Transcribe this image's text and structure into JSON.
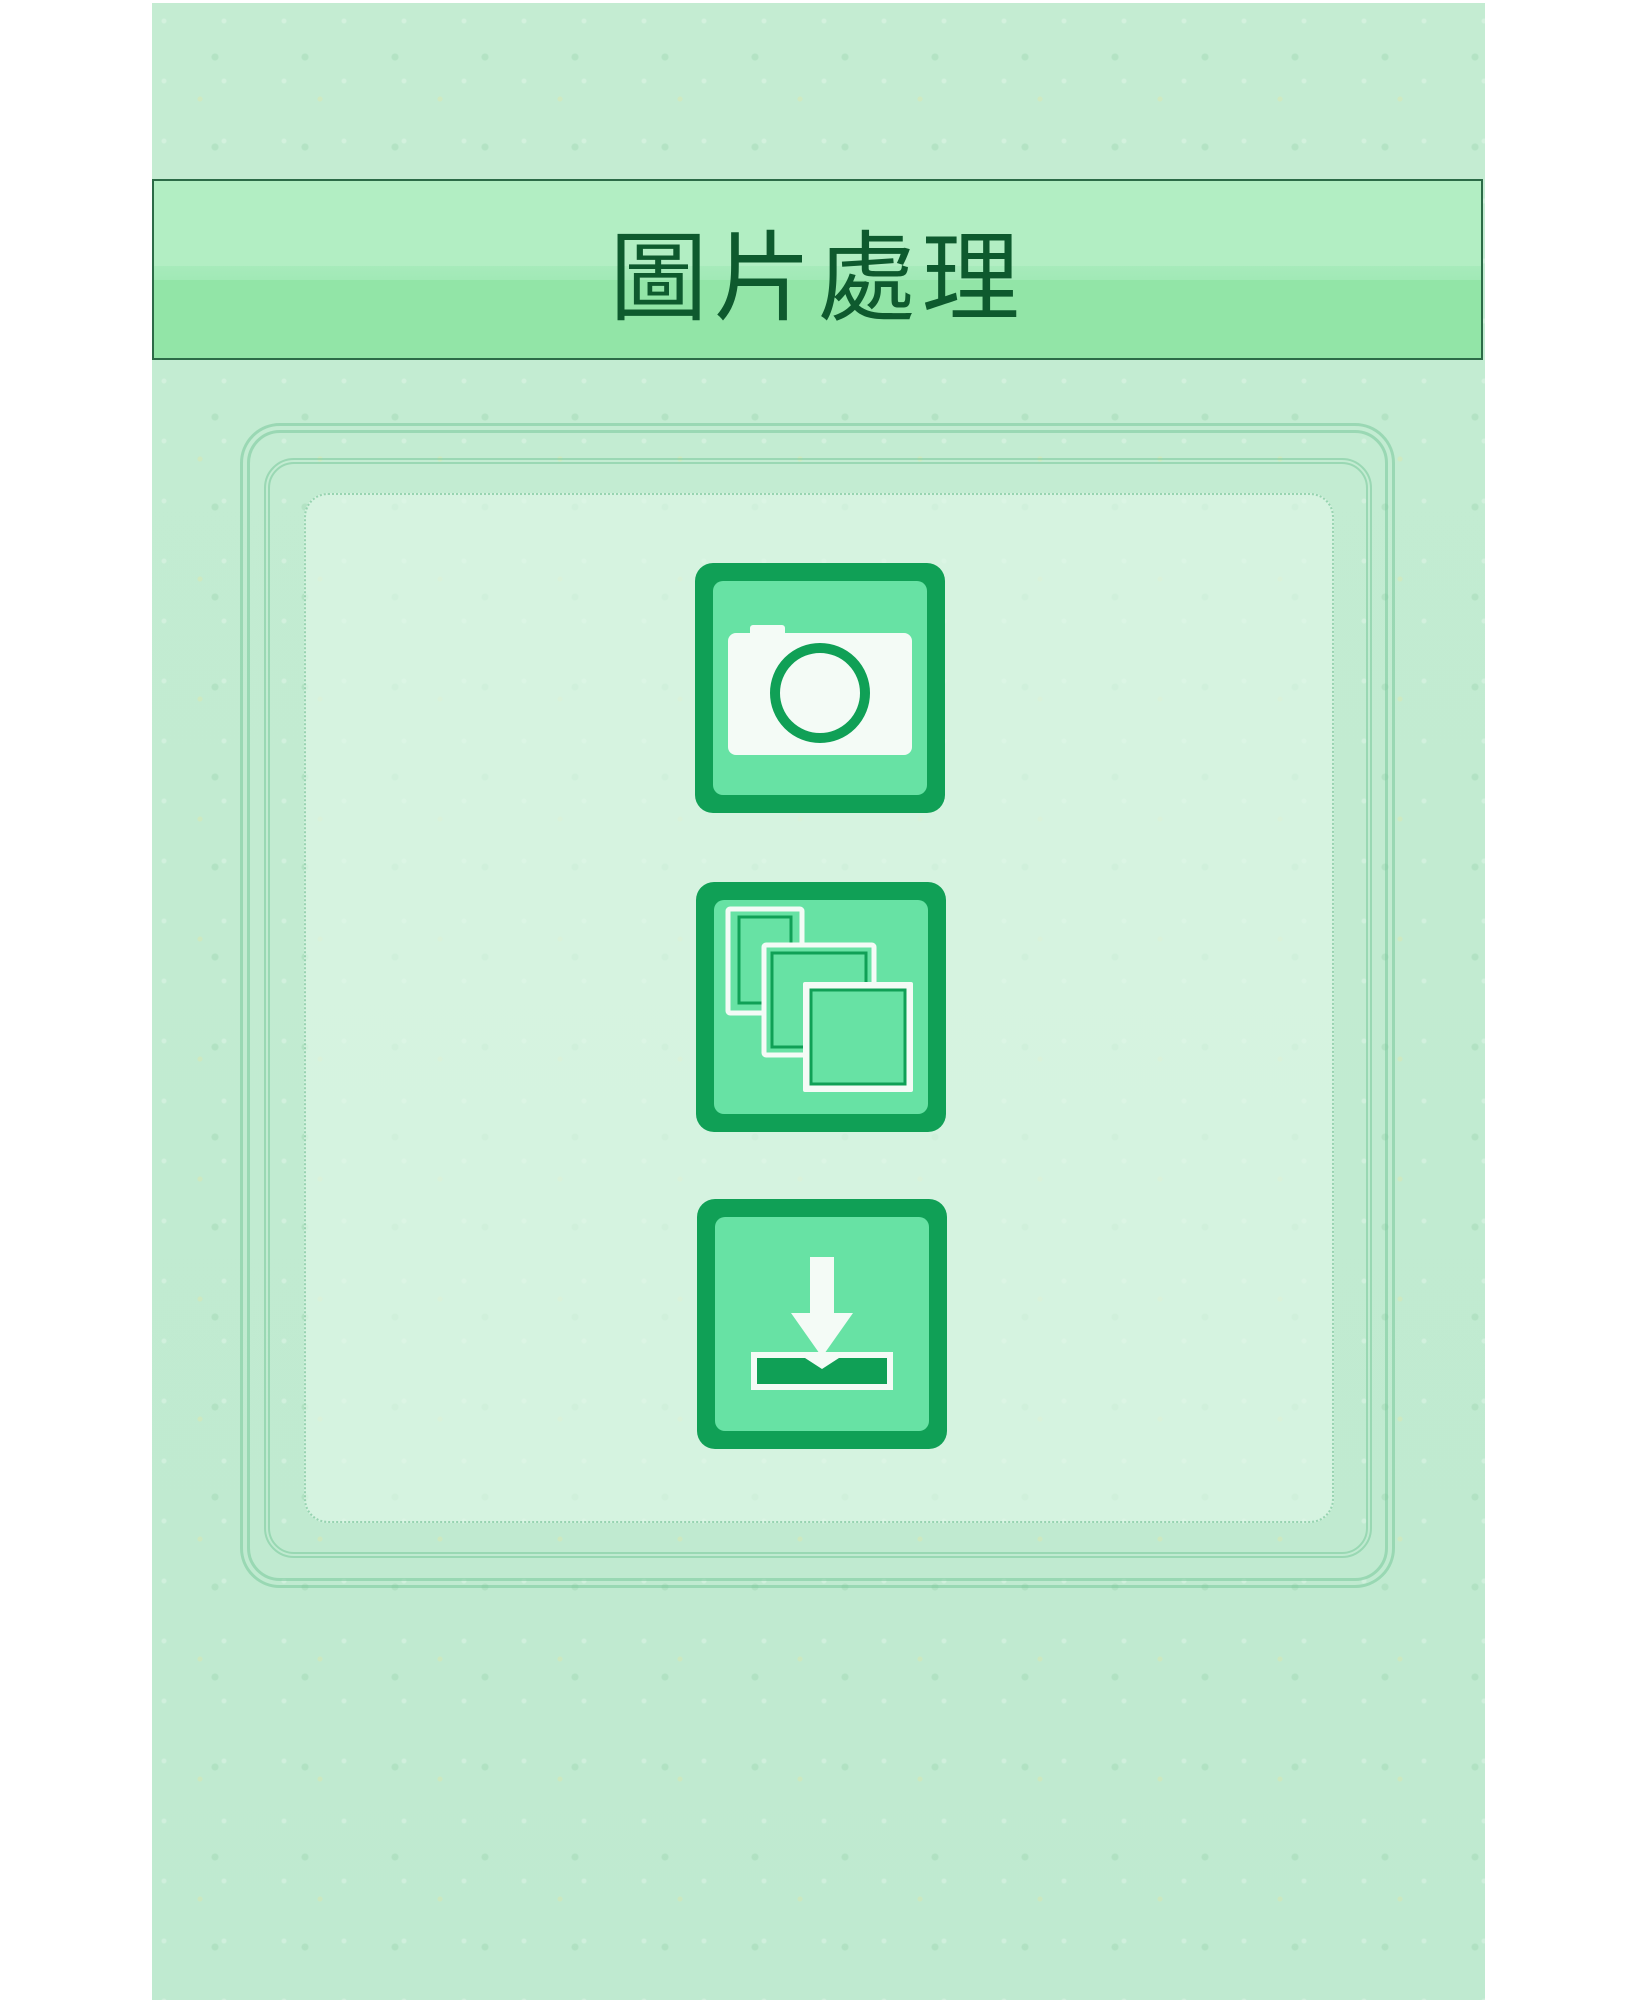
{
  "header": {
    "title": "圖片處理"
  },
  "buttons": [
    {
      "icon": "camera-icon"
    },
    {
      "icon": "stacked-images-icon"
    },
    {
      "icon": "download-icon"
    }
  ],
  "colors": {
    "background": "#c4ecd2",
    "title_bar": "#a7ebbb",
    "title_text": "#0e5a2e",
    "button_dark": "#10a056",
    "button_light": "#67e2a4",
    "icon_white": "#f4fbf6"
  }
}
